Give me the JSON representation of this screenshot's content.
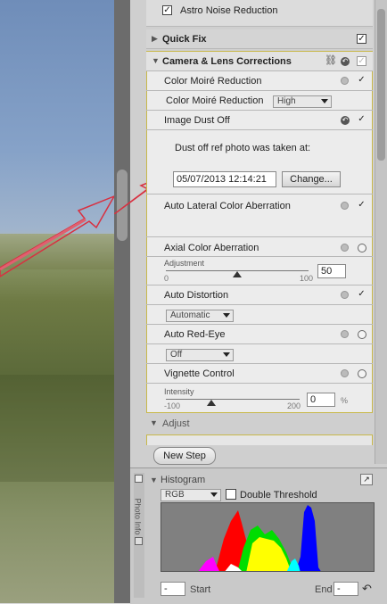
{
  "top": {
    "astro_label": "Astro Noise Reduction"
  },
  "quickfix": {
    "label": "Quick Fix"
  },
  "camera": {
    "title": "Camera & Lens Corrections",
    "color_moire": {
      "label": "Color Moiré Reduction",
      "sub_label": "Color Moiré Reduction",
      "value": "High"
    },
    "dust": {
      "label": "Image Dust Off",
      "prompt": "Dust off ref photo was taken at:",
      "date": "05/07/2013 12:14:21",
      "change_label": "Change..."
    },
    "lateral": {
      "label": "Auto Lateral Color Aberration"
    },
    "axial": {
      "label": "Axial Color Aberration",
      "adjust_label": "Adjustment",
      "min": "0",
      "max": "100",
      "value": "50"
    },
    "distortion": {
      "label": "Auto Distortion",
      "value": "Automatic"
    },
    "redeye": {
      "label": "Auto Red-Eye",
      "value": "Off"
    },
    "vignette": {
      "label": "Vignette Control",
      "intensity_label": "Intensity",
      "min": "-100",
      "max": "200",
      "value": "0",
      "unit": "%"
    }
  },
  "adjust": {
    "label": "Adjust"
  },
  "new_step": {
    "label": "New Step"
  },
  "histogram": {
    "title": "Histogram",
    "channel": "RGB",
    "double_threshold": "Double Threshold",
    "side_label": "Photo Info",
    "start_value": "-",
    "start_label": "Start",
    "end_label": "End",
    "end_value": "-"
  }
}
